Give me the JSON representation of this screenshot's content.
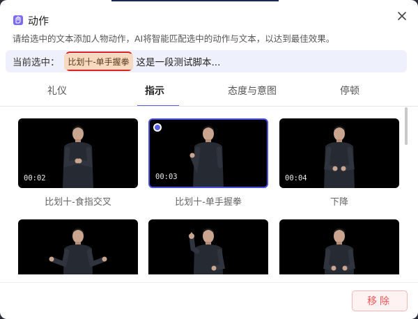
{
  "dialog": {
    "title": "动作",
    "icon": "sign-language-icon",
    "description": "请给选中的文本添加人物动作，AI将智能匹配选中的动作与文本，以达到最佳效果。"
  },
  "selection": {
    "label": "当前选中：",
    "tag": "比划十-单手握拳",
    "text": "这是一段测试脚本..."
  },
  "tabs": [
    {
      "label": "礼仪"
    },
    {
      "label": "指示"
    },
    {
      "label": "态度与意图"
    },
    {
      "label": "停顿"
    }
  ],
  "active_tab": "指示",
  "cards": [
    {
      "duration": "00:02",
      "caption": "比划十-食指交叉",
      "selected": false
    },
    {
      "duration": "00:03",
      "caption": "比划十-单手握拳",
      "selected": true
    },
    {
      "duration": "00:04",
      "caption": "下降",
      "selected": false
    },
    {
      "duration": "",
      "caption": "",
      "selected": false
    },
    {
      "duration": "",
      "caption": "",
      "selected": false
    },
    {
      "duration": "",
      "caption": "",
      "selected": false
    }
  ],
  "footer": {
    "remove_label": "移除"
  },
  "colors": {
    "accent": "#5a60e8",
    "highlight_border": "#e02020",
    "tag_bg": "#f6d9bf",
    "remove_text": "#f25555"
  }
}
